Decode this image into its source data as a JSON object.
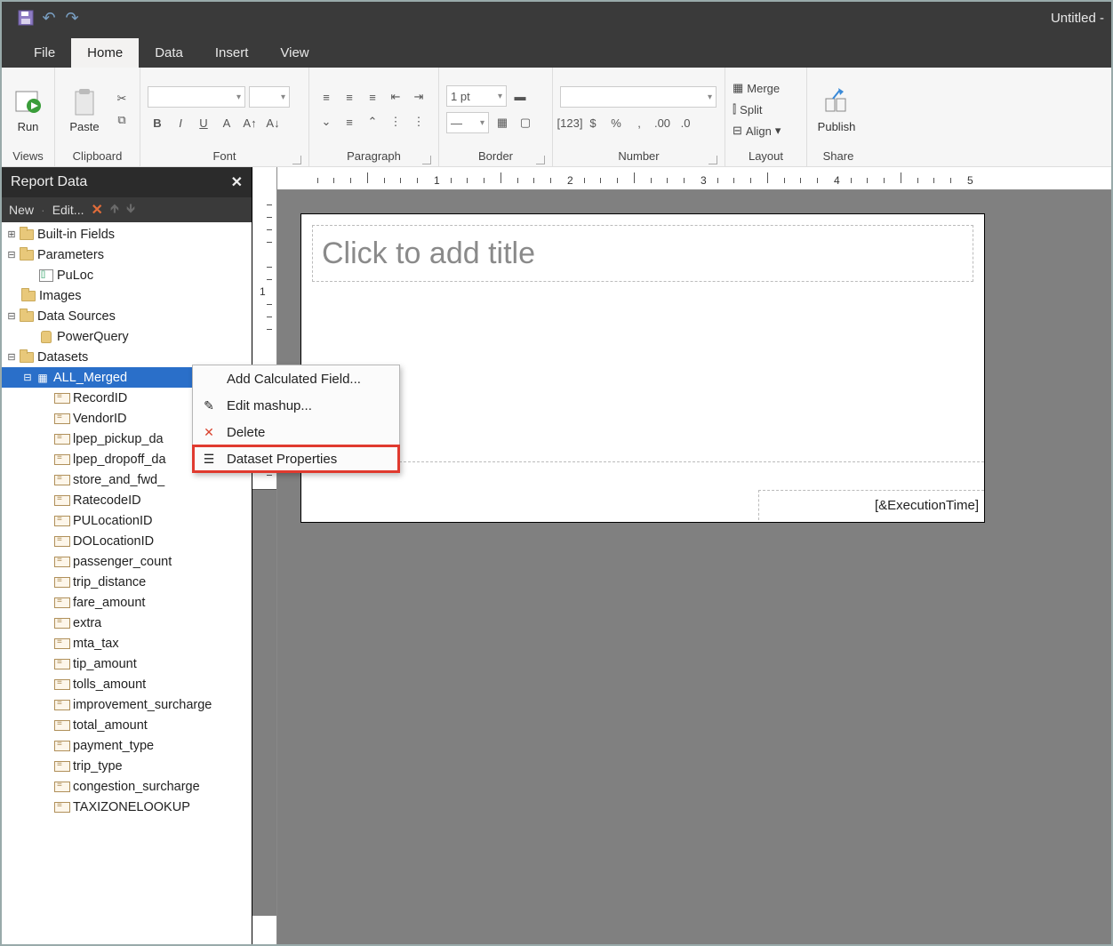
{
  "doc_title": "Untitled -",
  "tabs": {
    "file": "File",
    "home": "Home",
    "data": "Data",
    "insert": "Insert",
    "view": "View"
  },
  "active_tab": "home",
  "ribbon": {
    "views": {
      "label": "Views",
      "run": "Run"
    },
    "clipboard": {
      "label": "Clipboard",
      "paste": "Paste"
    },
    "font": {
      "label": "Font"
    },
    "paragraph": {
      "label": "Paragraph"
    },
    "border": {
      "label": "Border",
      "weight": "1 pt"
    },
    "number": {
      "label": "Number"
    },
    "layout": {
      "label": "Layout",
      "merge": "Merge",
      "split": "Split",
      "align": "Align"
    },
    "share": {
      "label": "Share",
      "publish": "Publish"
    }
  },
  "report_data": {
    "title": "Report Data",
    "toolbar": {
      "new": "New",
      "edit": "Edit..."
    },
    "tree": {
      "builtin": "Built-in Fields",
      "parameters": "Parameters",
      "param_items": [
        "PuLoc"
      ],
      "images": "Images",
      "datasources": "Data Sources",
      "ds_items": [
        "PowerQuery"
      ],
      "datasets": "Datasets",
      "dataset_name": "ALL_Merged",
      "fields": [
        "RecordID",
        "VendorID",
        "lpep_pickup_da",
        "lpep_dropoff_da",
        "store_and_fwd_",
        "RatecodeID",
        "PULocationID",
        "DOLocationID",
        "passenger_count",
        "trip_distance",
        "fare_amount",
        "extra",
        "mta_tax",
        "tip_amount",
        "tolls_amount",
        "improvement_surcharge",
        "total_amount",
        "payment_type",
        "trip_type",
        "congestion_surcharge",
        "TAXIZONELOOKUP"
      ]
    }
  },
  "context_menu": {
    "items": {
      "add_calc": "Add Calculated Field...",
      "edit_mashup": "Edit mashup...",
      "delete": "Delete",
      "props": "Dataset Properties"
    },
    "highlighted": "props"
  },
  "canvas": {
    "title_placeholder": "Click to add title",
    "footer_expr": "[&ExecutionTime]",
    "hruler_marks": [
      "1",
      "2",
      "3",
      "4",
      "5"
    ]
  }
}
